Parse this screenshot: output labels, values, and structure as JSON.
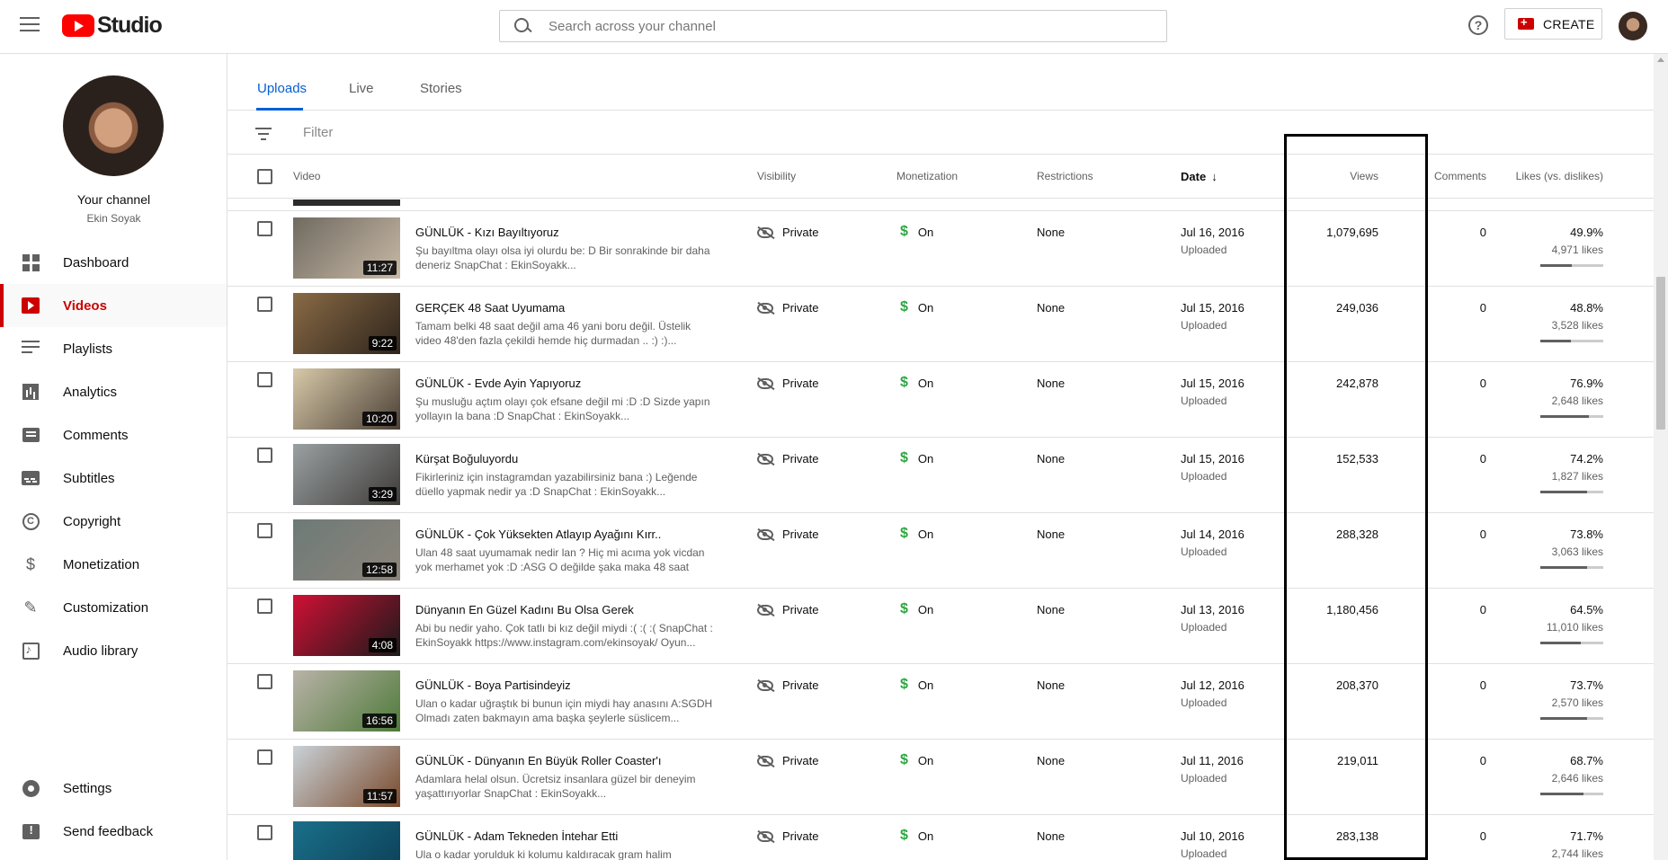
{
  "header": {
    "logo_text": "Studio",
    "search_placeholder": "Search across your channel",
    "help_label": "?",
    "create_label": "CREATE"
  },
  "sidebar": {
    "channel_title": "Your channel",
    "channel_name": "Ekin Soyak",
    "items": [
      {
        "label": "Dashboard",
        "icon": "dashboard-icon"
      },
      {
        "label": "Videos",
        "icon": "video-icon",
        "active": true
      },
      {
        "label": "Playlists",
        "icon": "playlist-icon"
      },
      {
        "label": "Analytics",
        "icon": "analytics-icon"
      },
      {
        "label": "Comments",
        "icon": "comment-icon"
      },
      {
        "label": "Subtitles",
        "icon": "subtitles-icon"
      },
      {
        "label": "Copyright",
        "icon": "copyright-icon"
      },
      {
        "label": "Monetization",
        "icon": "dollar-icon"
      },
      {
        "label": "Customization",
        "icon": "wand-icon"
      },
      {
        "label": "Audio library",
        "icon": "audio-library-icon"
      }
    ],
    "bottom_items": [
      {
        "label": "Settings",
        "icon": "gear-icon"
      },
      {
        "label": "Send feedback",
        "icon": "feedback-icon"
      }
    ]
  },
  "tabs": [
    {
      "label": "Uploads",
      "active": true
    },
    {
      "label": "Live"
    },
    {
      "label": "Stories"
    }
  ],
  "filter": {
    "placeholder": "Filter"
  },
  "columns": {
    "video": "Video",
    "visibility": "Visibility",
    "monetization": "Monetization",
    "restrictions": "Restrictions",
    "date": "Date",
    "views": "Views",
    "comments": "Comments",
    "likes": "Likes (vs. dislikes)"
  },
  "rows": [
    {
      "title": "GÜNLÜK - Kızı Bayıltıyoruz",
      "desc": "Şu bayıltma olayı olsa iyi olurdu be: D Bir sonrakinde bir daha deneriz SnapChat : EkinSoyakk...",
      "duration": "11:27",
      "visibility": "Private",
      "monetization": "On",
      "restrictions": "None",
      "date": "Jul 16, 2016",
      "date_sub": "Uploaded",
      "views": "1,079,695",
      "comments": "0",
      "likes_pct": "49.9%",
      "likes_count": "4,971 likes",
      "likes_ratio": 0.499,
      "thumb_colors": [
        "#6f6a60",
        "#c9b9a6"
      ]
    },
    {
      "title": "GERÇEK 48 Saat Uyumama",
      "desc": "Tamam belki 48 saat değil ama 46 yani boru değil. Üstelik video 48'den fazla çekildi hemde hiç durmadan .. :) :)...",
      "duration": "9:22",
      "visibility": "Private",
      "monetization": "On",
      "restrictions": "None",
      "date": "Jul 15, 2016",
      "date_sub": "Uploaded",
      "views": "249,036",
      "comments": "0",
      "likes_pct": "48.8%",
      "likes_count": "3,528 likes",
      "likes_ratio": 0.488,
      "thumb_colors": [
        "#8a6a45",
        "#2d241c"
      ]
    },
    {
      "title": "GÜNLÜK - Evde Ayin Yapıyoruz",
      "desc": "Şu musluğu açtım olayı çok efsane değil mi :D :D Sizde yapın yollayın la bana :D SnapChat : EkinSoyakk...",
      "duration": "10:20",
      "visibility": "Private",
      "monetization": "On",
      "restrictions": "None",
      "date": "Jul 15, 2016",
      "date_sub": "Uploaded",
      "views": "242,878",
      "comments": "0",
      "likes_pct": "76.9%",
      "likes_count": "2,648 likes",
      "likes_ratio": 0.769,
      "thumb_colors": [
        "#d8c9a8",
        "#4b4036"
      ]
    },
    {
      "title": "Kürşat Boğuluyordu",
      "desc": "Fikirleriniz için instagramdan yazabilirsiniz bana :) Leğende düello yapmak nedir ya :D SnapChat : EkinSoyakk...",
      "duration": "3:29",
      "visibility": "Private",
      "monetization": "On",
      "restrictions": "None",
      "date": "Jul 15, 2016",
      "date_sub": "Uploaded",
      "views": "152,533",
      "comments": "0",
      "likes_pct": "74.2%",
      "likes_count": "1,827 likes",
      "likes_ratio": 0.742,
      "thumb_colors": [
        "#9aa0a2",
        "#3e3b38"
      ]
    },
    {
      "title": "GÜNLÜK - Çok Yüksekten Atlayıp Ayağını Kırr..",
      "desc": "Ulan 48 saat uyumamak nedir lan ? Hiç mi acıma yok vicdan yok merhamet yok :D :ASG O değilde şaka maka 48 saat vide...",
      "duration": "12:58",
      "visibility": "Private",
      "monetization": "On",
      "restrictions": "None",
      "date": "Jul 14, 2016",
      "date_sub": "Uploaded",
      "views": "288,328",
      "comments": "0",
      "likes_pct": "73.8%",
      "likes_count": "3,063 likes",
      "likes_ratio": 0.738,
      "thumb_colors": [
        "#6d7a78",
        "#8d857a"
      ]
    },
    {
      "title": "Dünyanın En Güzel Kadını Bu Olsa Gerek",
      "desc": "Abi bu nedir yaho. Çok tatlı bi kız değil miydi :( :( :( SnapChat : EkinSoyakk https://www.instagram.com/ekinsoyak/ Oyun...",
      "duration": "4:08",
      "visibility": "Private",
      "monetization": "On",
      "restrictions": "None",
      "date": "Jul 13, 2016",
      "date_sub": "Uploaded",
      "views": "1,180,456",
      "comments": "0",
      "likes_pct": "64.5%",
      "likes_count": "11,010 likes",
      "likes_ratio": 0.645,
      "thumb_colors": [
        "#d01035",
        "#1a1a1a"
      ]
    },
    {
      "title": "GÜNLÜK - Boya Partisindeyiz",
      "desc": "Ulan o kadar uğraştık bi bunun için miydi hay anasını A:SGDH Olmadı zaten bakmayın ama başka şeylerle süslicem...",
      "duration": "16:56",
      "visibility": "Private",
      "monetization": "On",
      "restrictions": "None",
      "date": "Jul 12, 2016",
      "date_sub": "Uploaded",
      "views": "208,370",
      "comments": "0",
      "likes_pct": "73.7%",
      "likes_count": "2,570 likes",
      "likes_ratio": 0.737,
      "thumb_colors": [
        "#b9b3a8",
        "#4f7a3a"
      ]
    },
    {
      "title": "GÜNLÜK - Dünyanın En Büyük Roller Coaster'ı",
      "desc": "Adamlara helal olsun. Ücretsiz insanlara güzel bir deneyim yaşattırıyorlar SnapChat : EkinSoyakk...",
      "duration": "11:57",
      "visibility": "Private",
      "monetization": "On",
      "restrictions": "None",
      "date": "Jul 11, 2016",
      "date_sub": "Uploaded",
      "views": "219,011",
      "comments": "0",
      "likes_pct": "68.7%",
      "likes_count": "2,646 likes",
      "likes_ratio": 0.687,
      "thumb_colors": [
        "#c9d2d8",
        "#7a4a2c"
      ]
    },
    {
      "title": "GÜNLÜK - Adam Tekneden İntehar Etti",
      "desc": "Ula o kadar yorulduk ki kolumu kaldıracak gram halim",
      "duration": "",
      "visibility": "Private",
      "monetization": "On",
      "restrictions": "None",
      "date": "Jul 10, 2016",
      "date_sub": "Uploaded",
      "views": "283,138",
      "comments": "0",
      "likes_pct": "71.7%",
      "likes_count": "2,744 likes",
      "likes_ratio": 0.717,
      "thumb_colors": [
        "#1a6f8a",
        "#0c3e55"
      ]
    }
  ]
}
